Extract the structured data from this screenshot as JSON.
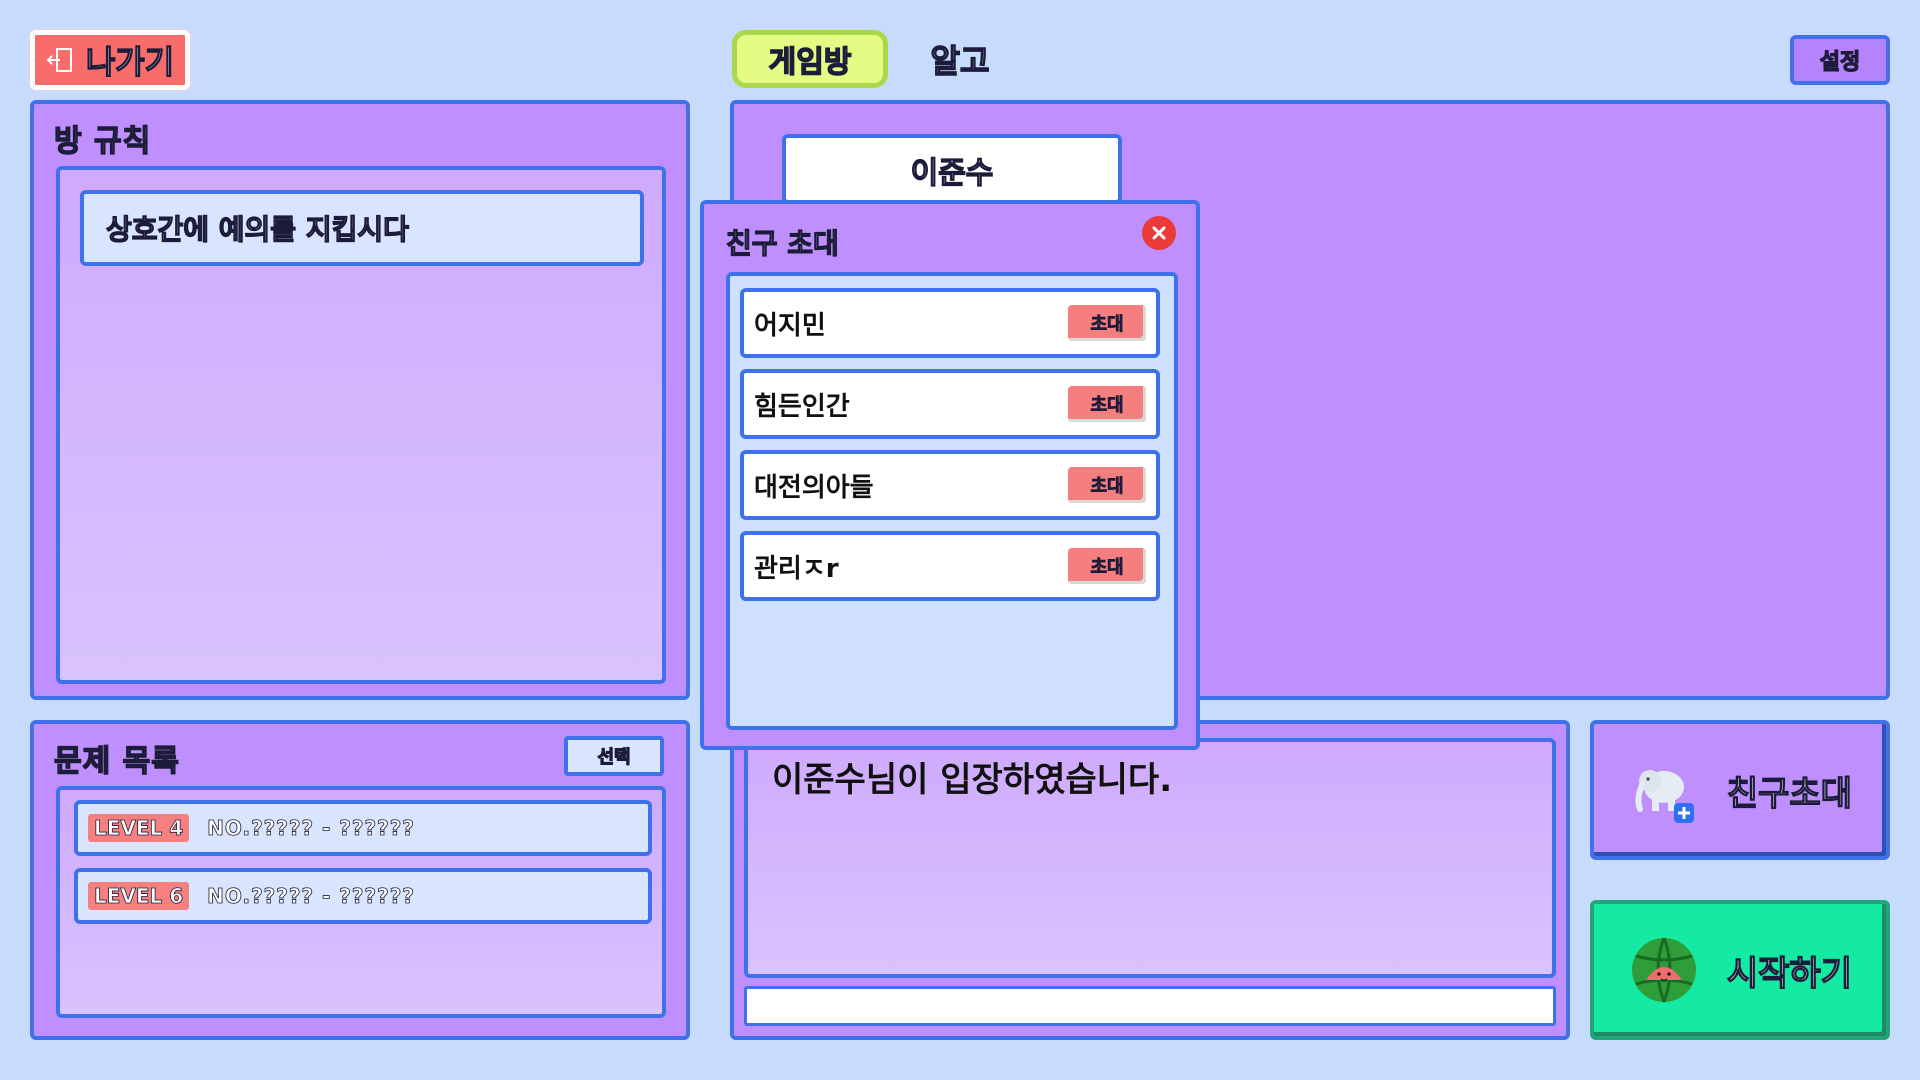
{
  "header": {
    "exit_label": "나가기",
    "tabs": [
      {
        "label": "게임방",
        "active": true
      },
      {
        "label": "알고",
        "active": false
      }
    ],
    "settings_label": "설정"
  },
  "rules": {
    "title": "방 규칙",
    "items": [
      "상호간에 예의를 지킵시다"
    ]
  },
  "problems": {
    "title": "문제 목록",
    "select_label": "선택",
    "items": [
      {
        "level": "LEVEL 4",
        "text": "NO.????? - ??????"
      },
      {
        "level": "LEVEL 6",
        "text": "NO.????? - ??????"
      }
    ]
  },
  "players": {
    "slots": [
      {
        "name": "이준수"
      }
    ]
  },
  "chat": {
    "messages": [
      "이준수님이 입장하였습니다."
    ],
    "input_value": ""
  },
  "actions": {
    "invite_label": "친구초대",
    "start_label": "시작하기"
  },
  "invite_modal": {
    "title": "친구 초대",
    "invite_button_label": "초대",
    "friends": [
      {
        "name": "어지민"
      },
      {
        "name": "힘든인간"
      },
      {
        "name": "대전의아들"
      },
      {
        "name": "관리ㅈr"
      }
    ]
  },
  "colors": {
    "background": "#c7dcfd",
    "panel": "#bf90fd",
    "border": "#3f72ea",
    "exit": "#f86c6c",
    "active_tab": "#e4fc83",
    "start": "#14eaa3",
    "close": "#ea3a3a"
  },
  "icons": {
    "exit": "door-exit-icon",
    "close": "close-icon",
    "invite": "elephant-plus-icon",
    "start": "watermelon-icon"
  }
}
